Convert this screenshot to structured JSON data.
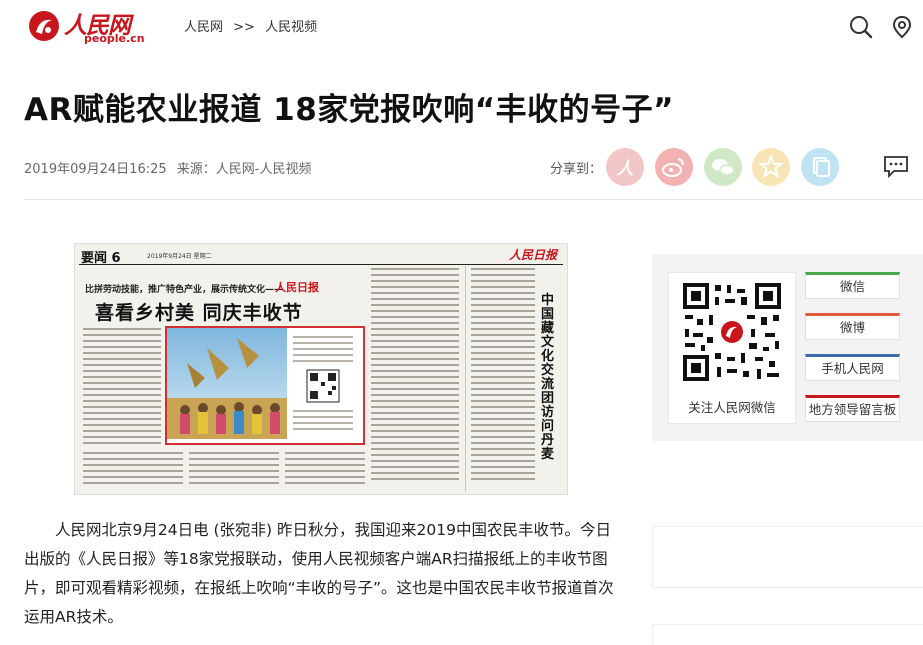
{
  "header": {
    "logo_cn": "人民网",
    "logo_en": "people.cn",
    "breadcrumb": [
      "人民网",
      ">>",
      "人民视频"
    ],
    "icons": [
      "search-icon",
      "location-icon"
    ]
  },
  "article": {
    "title": "AR赋能农业报道 18家党报吹响“丰收的号子”",
    "date": "2019年09月24日16:25",
    "source": "来源：人民网-人民视频",
    "share_label": "分享到：",
    "share_buttons": [
      {
        "name": "people-weibo",
        "color": "#f2c6c6"
      },
      {
        "name": "sina-weibo",
        "color": "#f3b2b2"
      },
      {
        "name": "wechat",
        "color": "#cfe8c5"
      },
      {
        "name": "favorite",
        "color": "#f7e5b5"
      },
      {
        "name": "copy",
        "color": "#bfe3f2"
      }
    ],
    "body": "人民网北京9月24日电 (张宛非) 昨日秋分，我国迎来2019中国农民丰收节。今日出版的《人民日报》等18家党报联动，使用人民视频客户端AR扫描报纸上的丰收节图片，即可观看精彩视频，在报纸上吹响“丰收的号子”。这也是中国农民丰收节报道首次运用AR技术。"
  },
  "newspaper": {
    "section": "要闻 6",
    "date": "2019年9月24日 星期二",
    "masthead": "人民日报",
    "subhead": "比拼劳动技能，推广特色产业，展示传统文化——",
    "tag": "人民日报",
    "headline": "喜看乡村美  同庆丰收节",
    "vertical_headline": "中国藏文化交流团访问丹麦"
  },
  "sidebar": {
    "qr_label": "关注人民网微信",
    "buttons": [
      {
        "label": "微信",
        "color": "#49a84c"
      },
      {
        "label": "微博",
        "color": "#e05a3a"
      },
      {
        "label": "手机人民网",
        "color": "#3b6ea8"
      },
      {
        "label": "地方领导留言板",
        "color": "#c8161d"
      }
    ]
  },
  "colors": {
    "brand": "#c8161d"
  }
}
